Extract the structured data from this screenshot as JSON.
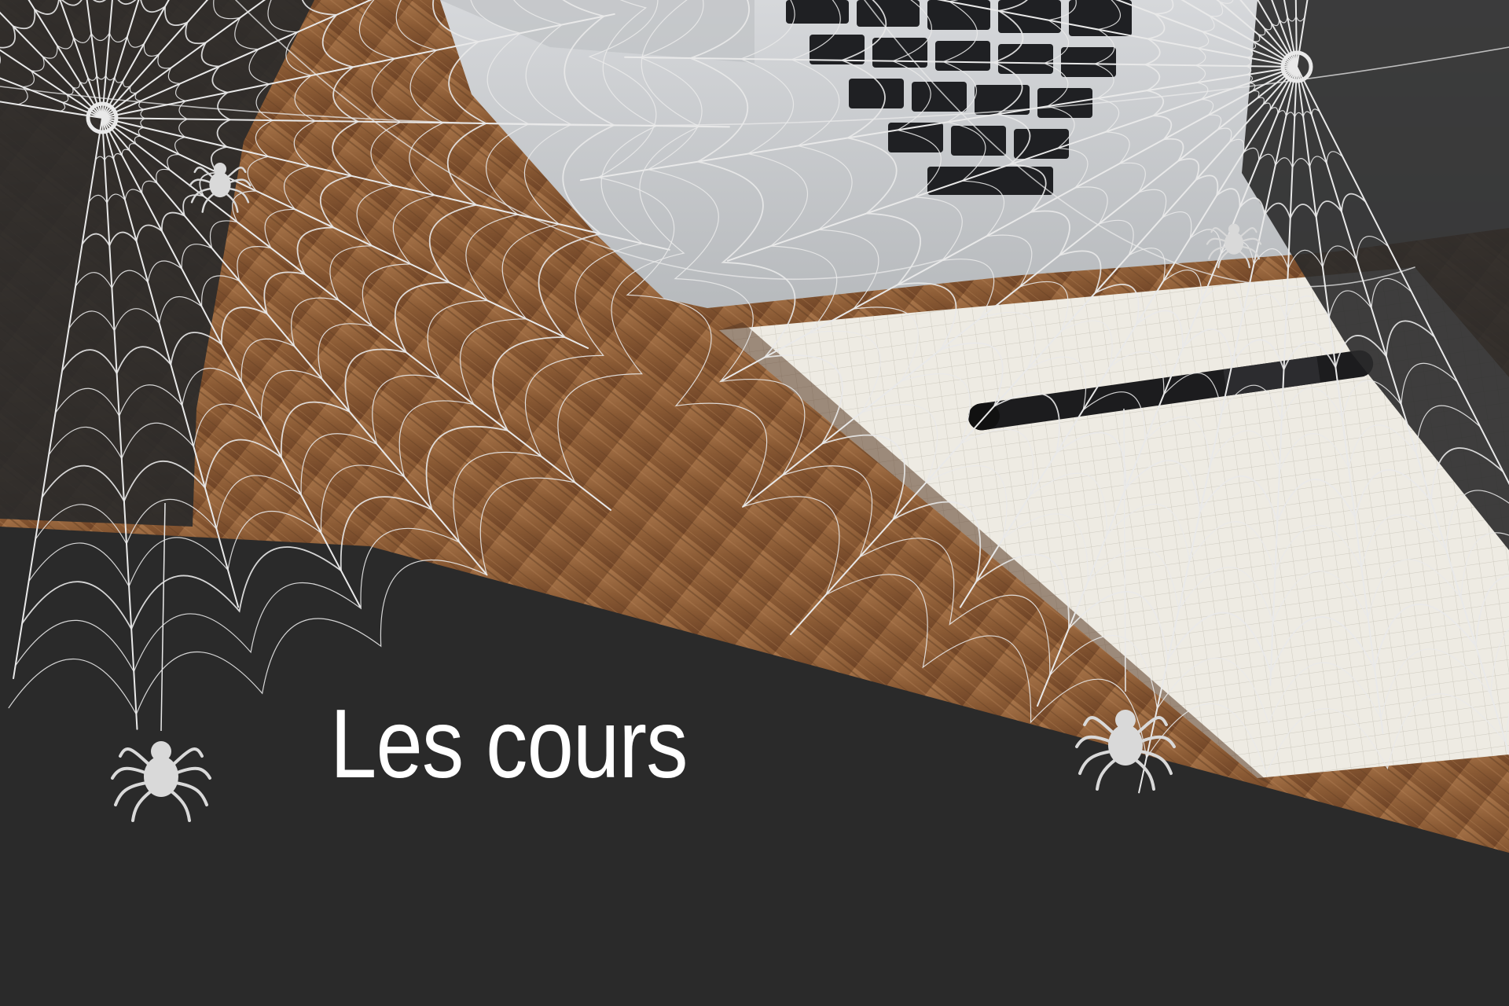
{
  "banner": {
    "title": "Les cours"
  },
  "icons": [
    "spider-web-icon",
    "spider-icon"
  ],
  "colors": {
    "panel": "#2a2a2a",
    "web": "#e9e9e9",
    "wood": "#8a5a34",
    "laptop": "#c9cbce",
    "notebook": "#eeebe3",
    "title": "#ffffff"
  }
}
